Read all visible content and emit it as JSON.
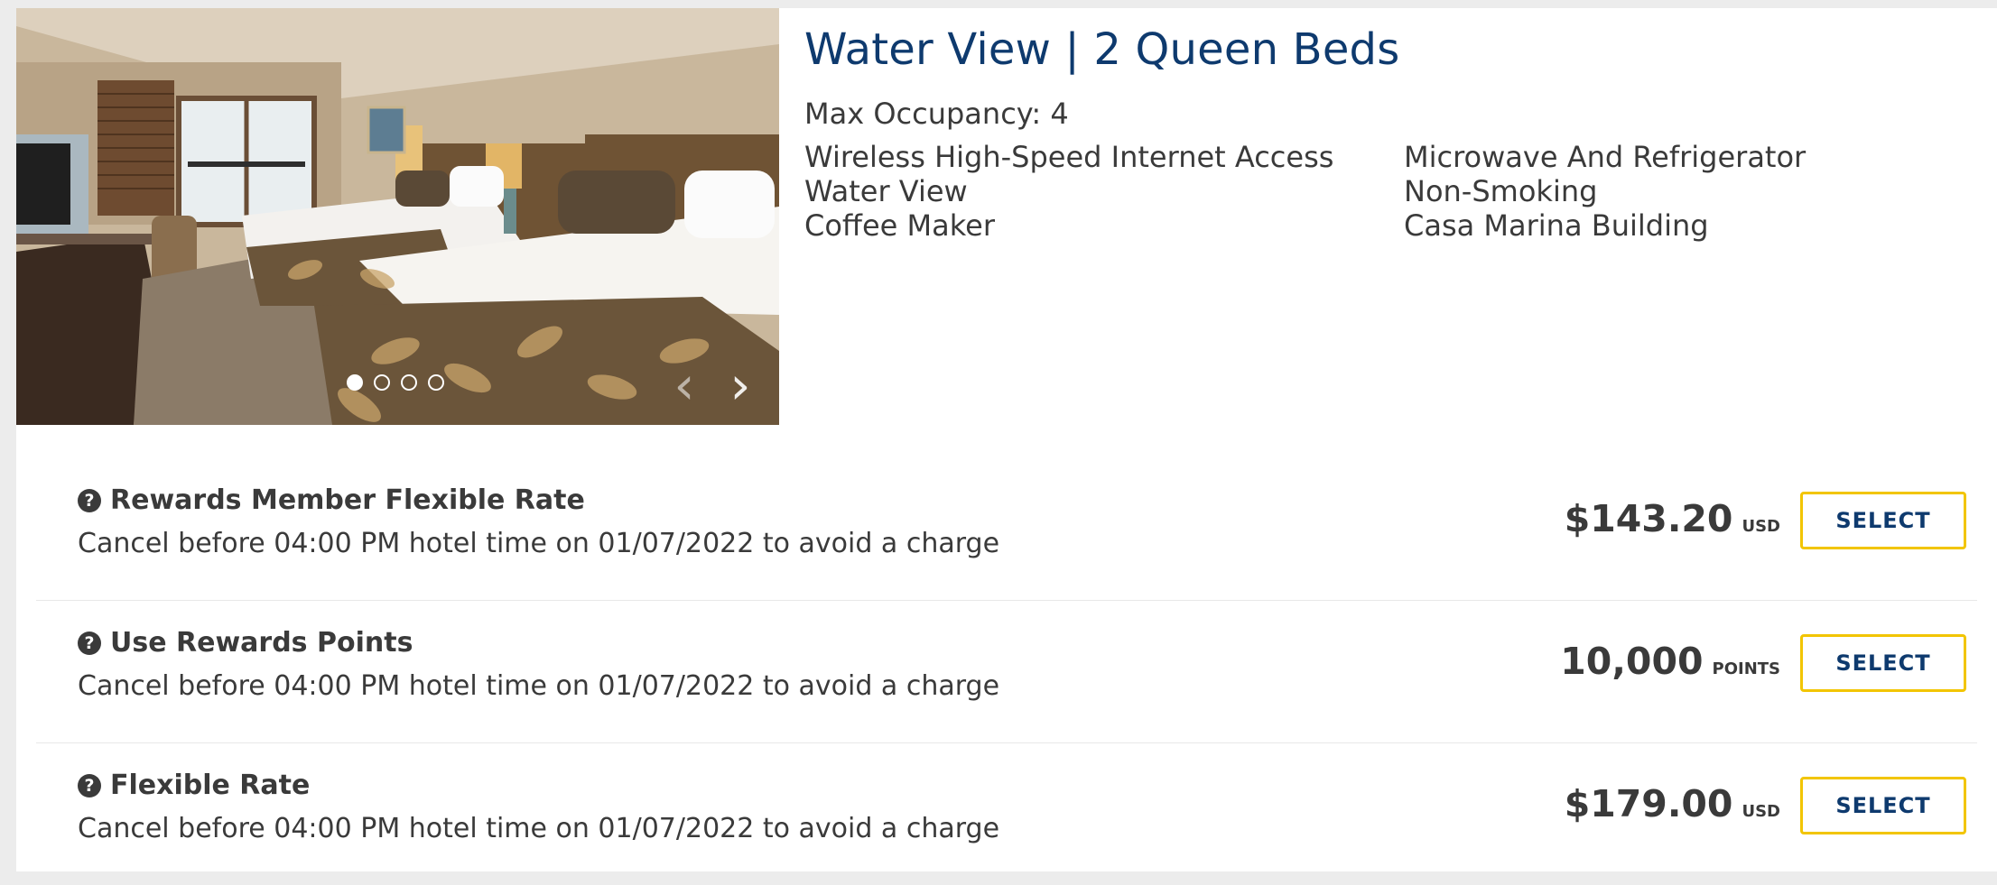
{
  "room": {
    "title": "Water View | 2 Queen Beds",
    "occupancy": "Max Occupancy: 4",
    "amenities_left": [
      "Wireless High-Speed Internet Access",
      "Water View",
      "Coffee Maker"
    ],
    "amenities_right": [
      "Microwave And Refrigerator",
      "Non-Smoking",
      "Casa Marina Building"
    ]
  },
  "gallery": {
    "image_count": 4,
    "active_index": 0,
    "prev_icon": "chevron-left-icon",
    "next_icon": "chevron-right-icon",
    "prev_glyph": "‹",
    "next_glyph": "›"
  },
  "rates": [
    {
      "name": "Rewards Member Flexible Rate",
      "cancel": "Cancel before 04:00 PM hotel time on 01/07/2022 to avoid a charge",
      "price": "$143.20",
      "unit": "USD",
      "button": "SELECT"
    },
    {
      "name": "Use Rewards Points",
      "cancel": "Cancel before 04:00 PM hotel time on 01/07/2022 to avoid a charge",
      "price": "10,000",
      "unit": "POINTS",
      "button": "SELECT"
    },
    {
      "name": "Flexible Rate",
      "cancel": "Cancel before 04:00 PM hotel time on 01/07/2022 to avoid a charge",
      "price": "$179.00",
      "unit": "USD",
      "button": "SELECT"
    }
  ],
  "icons": {
    "help": "question-circle-icon",
    "help_glyph": "?"
  },
  "colors": {
    "title": "#0e3a6e",
    "button_border": "#f2c500",
    "button_text": "#0e3a6e",
    "text": "#3a3a3a"
  }
}
